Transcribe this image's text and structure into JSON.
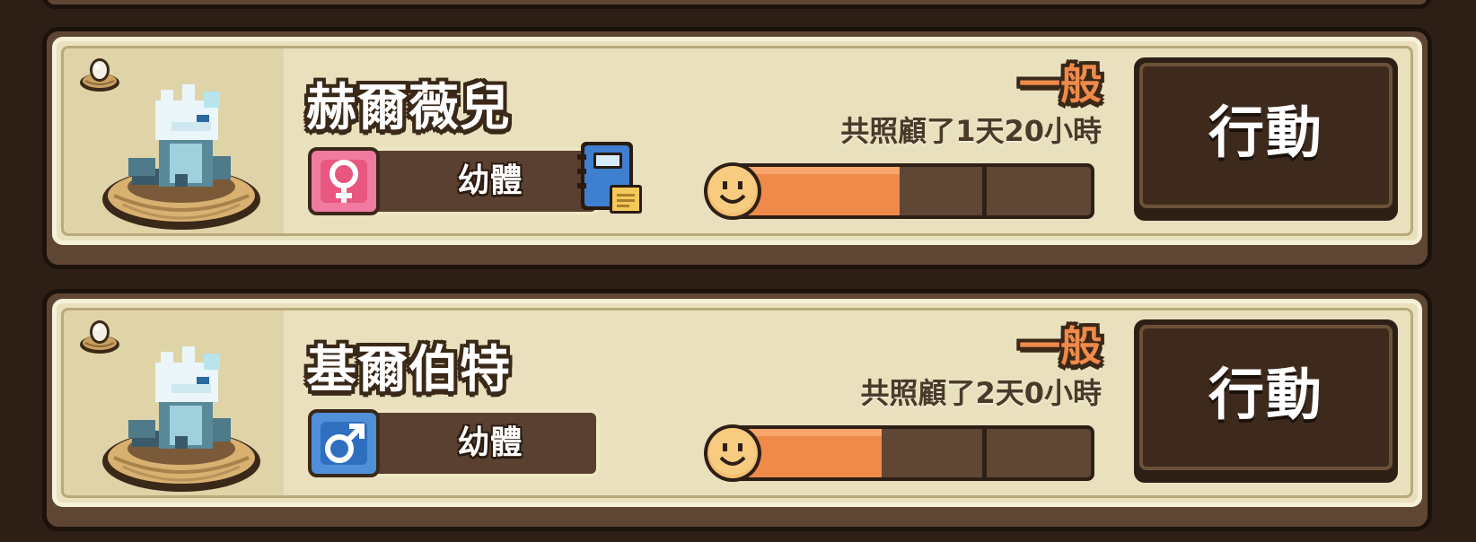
{
  "pets": [
    {
      "name": "赫爾薇兒",
      "gender": "female",
      "gender_symbol": "♀",
      "stage": "幼體",
      "has_notebook": true,
      "mood_label": "一般",
      "care_time": "共照顧了1天20小時",
      "mood_level": 0.47,
      "action_label": "行動"
    },
    {
      "name": "基爾伯特",
      "gender": "male",
      "gender_symbol": "♂",
      "stage": "幼體",
      "has_notebook": false,
      "mood_label": "一般",
      "care_time": "共照顧了2天0小時",
      "mood_level": 0.42,
      "action_label": "行動"
    }
  ],
  "colors": {
    "background": "#2e1f16",
    "card_face": "#e9e0be",
    "mood_fill": "#ef8a4a",
    "female": "#e8577f",
    "male": "#2f6fc0"
  }
}
